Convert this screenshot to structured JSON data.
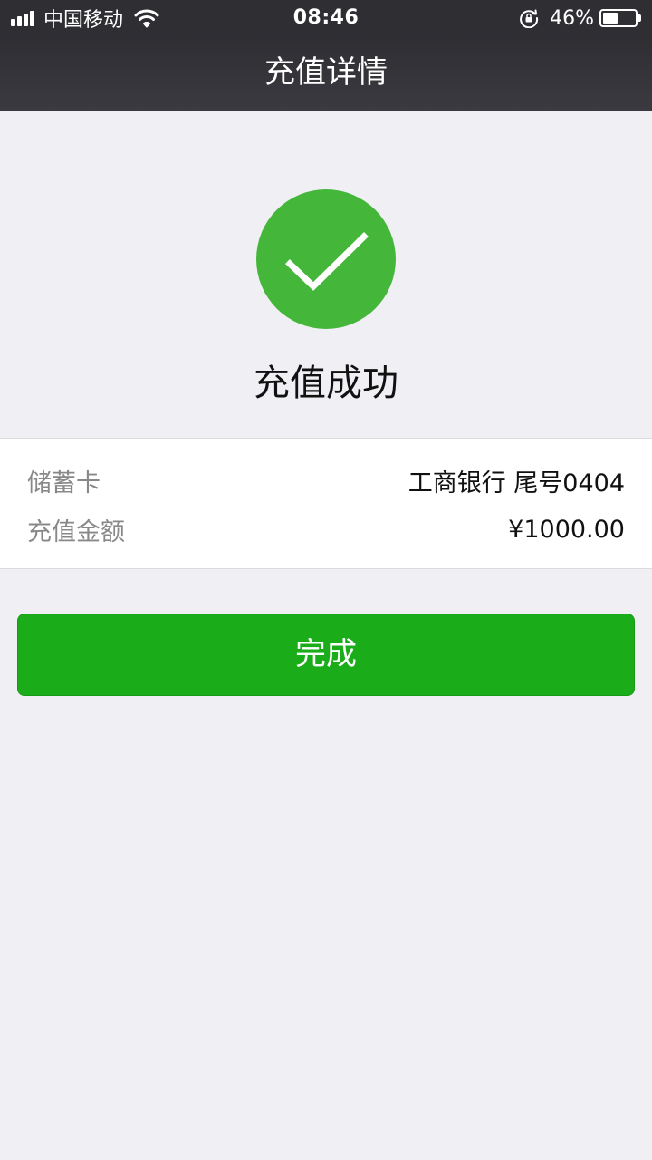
{
  "status_bar": {
    "carrier": "中国移动",
    "time": "08:46",
    "battery_percent": "46%",
    "battery_level": 0.46,
    "signal_bars": 4
  },
  "navbar": {
    "title": "充值详情"
  },
  "result": {
    "icon": "check-circle-icon",
    "title": "充值成功",
    "accent_color": "#44b73b"
  },
  "details": [
    {
      "label": "储蓄卡",
      "value": "工商银行 尾号0404"
    },
    {
      "label": "充值金额",
      "value": "¥1000.00"
    }
  ],
  "actions": {
    "done_label": "完成",
    "done_color": "#1aad19"
  }
}
